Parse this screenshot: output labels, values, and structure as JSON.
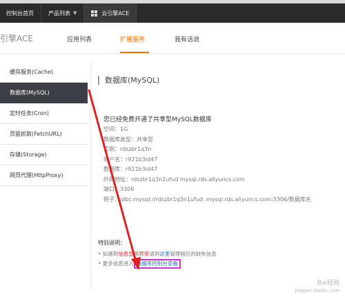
{
  "topbar": {
    "home": "控制台首页",
    "products": "产品列表",
    "app": "云引擎ACE"
  },
  "header": {
    "brand": "引擎ACE",
    "tabs": [
      "应用列表",
      "扩展服务",
      "我有话说"
    ]
  },
  "sidebar": {
    "items": [
      "缓存服务(Cache)",
      "数据库(MySQL)",
      "定时任务(Cron)",
      "页面抓取(FetchURL)",
      "存储(Storage)",
      "网页代理(HttpProxy)"
    ]
  },
  "main": {
    "title": "数据库(MySQL)",
    "info_title": "您已经免费开通了共享型MySQL数据库",
    "lines": [
      "空间：1G",
      "数据库类型：共享型",
      "实例：rdszbr1q3n",
      "账户名：r921b3id47",
      "数据库：r921b3id47",
      "外网地址：rdszbr1q3n1ufud          mysql.rds.aliyuncs.com",
      "端口：3306",
      "例子：jdbc:mysql://rdszbr1q3n1ufud       .mysql.rds.aliyuncs.com:3306/数据库名"
    ]
  },
  "notes": {
    "title": "特别说明：",
    "line1_prefix": "• 如遇到",
    "line1_red": "信息显示异常",
    "line1_mid": "请到",
    "line1_link": "这里",
    "line1_suffix": "管理相应的缺失信息",
    "line2_prefix": "• 更多信息进入",
    "line2_link": "数据库控制台查看"
  },
  "watermark": {
    "line1": "Bai经验",
    "line2": "jingyan.baidu.com"
  },
  "colors": {
    "accent": "#ff7200",
    "sidebar_active": "#3b3e44",
    "arrow": "#e02020",
    "highlight_box": "#cc33cc"
  }
}
